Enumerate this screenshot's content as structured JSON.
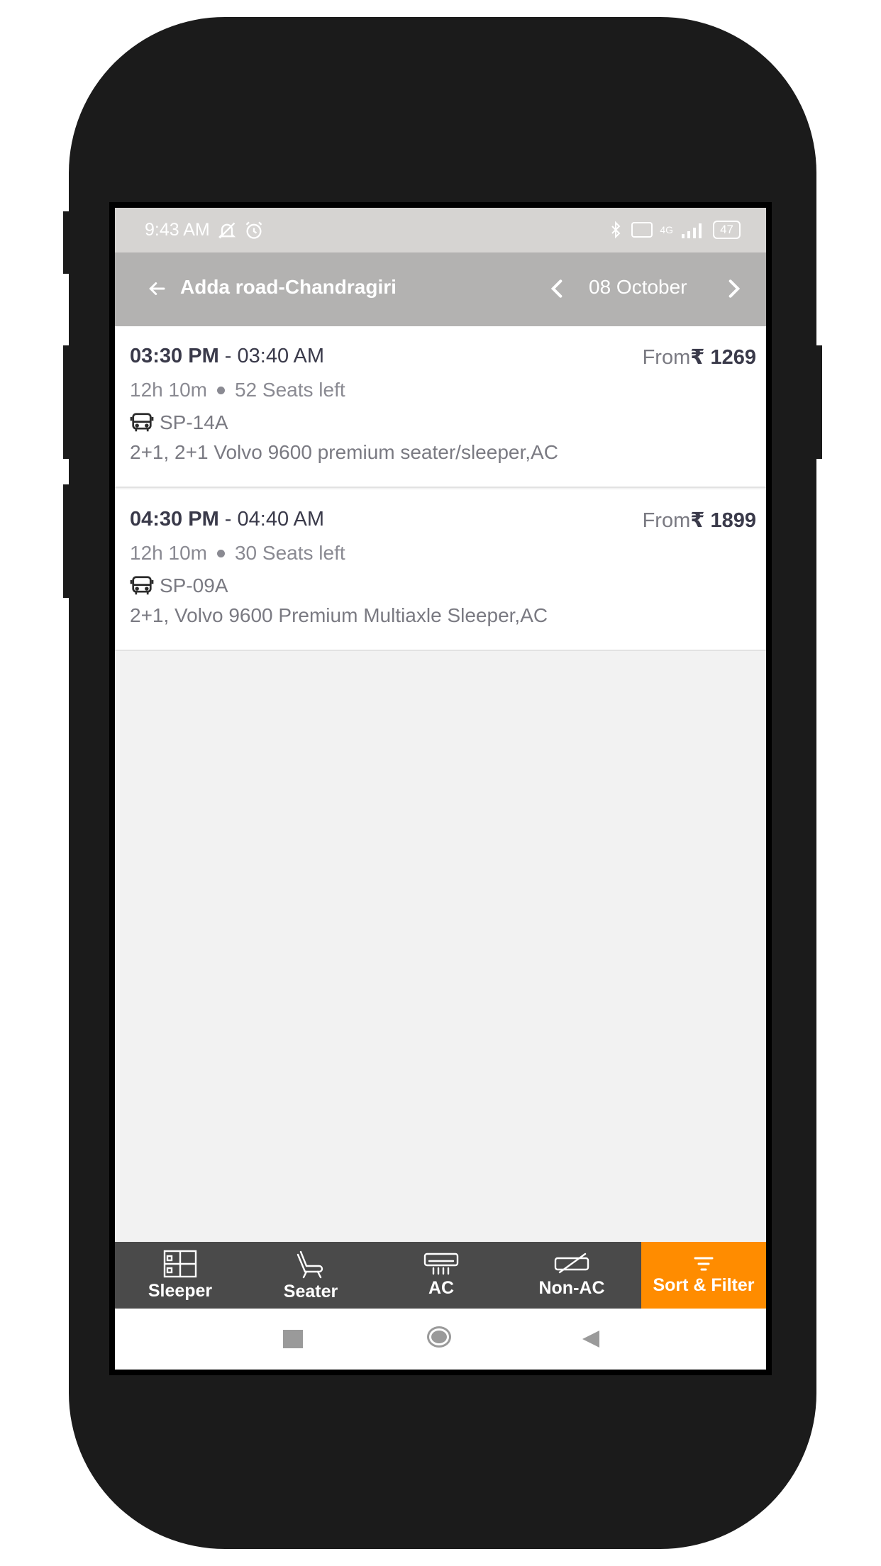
{
  "status_bar": {
    "time": "9:43 AM",
    "network": "4G",
    "battery": "47"
  },
  "header": {
    "title": "Adda road-Chandragiri",
    "date": "08 October"
  },
  "trips": [
    {
      "departure": "03:30 PM",
      "arrival": " - 03:40 AM",
      "price_prefix": "From",
      "price": "₹ 1269",
      "duration": "12h 10m",
      "seats": "52 Seats left",
      "code": "SP-14A",
      "description": "2+1, 2+1 Volvo 9600 premium seater/sleeper,AC"
    },
    {
      "departure": "04:30 PM",
      "arrival": " - 04:40 AM",
      "price_prefix": "From",
      "price": "₹ 1899",
      "duration": "12h 10m",
      "seats": "30 Seats left",
      "code": "SP-09A",
      "description": "2+1, Volvo 9600 Premium Multiaxle Sleeper,AC"
    }
  ],
  "bottom_tabs": {
    "sleeper": "Sleeper",
    "seater": "Seater",
    "ac": "AC",
    "non_ac": "Non-AC",
    "sort_filter": "Sort & Filter"
  },
  "colors": {
    "accent": "#ff8c00",
    "tab_bar": "#4a4a4a",
    "header": "#b3b2b1"
  },
  "icons": [
    "back-arrow-icon",
    "chevron-left-icon",
    "chevron-right-icon",
    "bus-icon",
    "sleeper-icon",
    "seater-icon",
    "ac-icon",
    "non-ac-icon",
    "filter-icon"
  ]
}
